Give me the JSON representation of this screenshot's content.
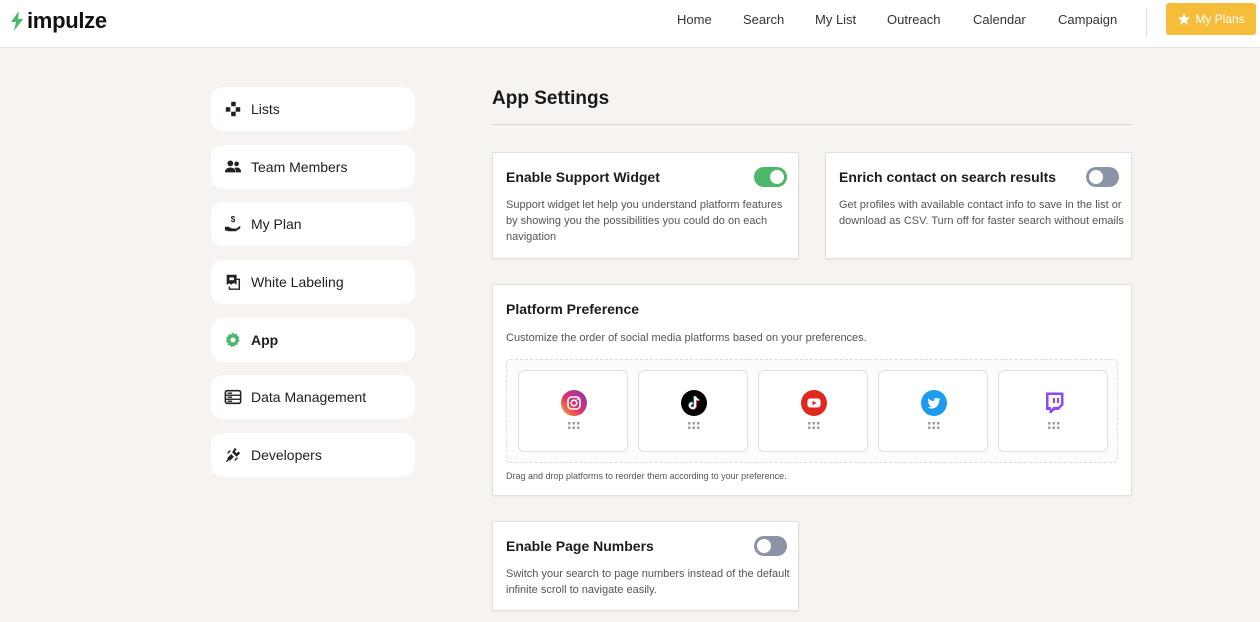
{
  "brand": {
    "name": "impulze",
    "accent": "#4cb86a"
  },
  "nav": {
    "items": [
      "Home",
      "Search",
      "My List",
      "Outreach",
      "Calendar",
      "Campaign"
    ],
    "plans_button": "My Plans",
    "plans_color": "#f5bd3a"
  },
  "sidebar": {
    "items": [
      {
        "label": "Lists",
        "icon": "lists-icon"
      },
      {
        "label": "Team Members",
        "icon": "team-members-icon"
      },
      {
        "label": "My Plan",
        "icon": "money-hand-icon"
      },
      {
        "label": "White Labeling",
        "icon": "white-label-icon"
      },
      {
        "label": "App",
        "icon": "gear-icon",
        "active": true
      },
      {
        "label": "Data Management",
        "icon": "server-icon"
      },
      {
        "label": "Developers",
        "icon": "plug-icon"
      }
    ]
  },
  "main": {
    "title": "App Settings",
    "support_widget": {
      "title": "Enable Support Widget",
      "desc": "Support widget let help you understand platform features by showing you the possibilities you could do on each navigation",
      "enabled": true
    },
    "enrich_contact": {
      "title": "Enrich contact on search results",
      "desc": "Get profiles with available contact info to save in the list or download as CSV. Turn off for faster search without emails",
      "enabled": false
    },
    "platform_preference": {
      "title": "Platform Preference",
      "desc": "Customize the order of social media platforms based on your preferences.",
      "platforms": [
        "instagram-icon",
        "tiktok-icon",
        "youtube-icon",
        "twitter-icon",
        "twitch-icon"
      ],
      "hint": "Drag and drop platforms to reorder them according to your preference."
    },
    "page_numbers": {
      "title": "Enable Page Numbers",
      "desc": "Switch your search to page numbers instead of the default infinite scroll to navigate easily.",
      "enabled": false
    }
  }
}
